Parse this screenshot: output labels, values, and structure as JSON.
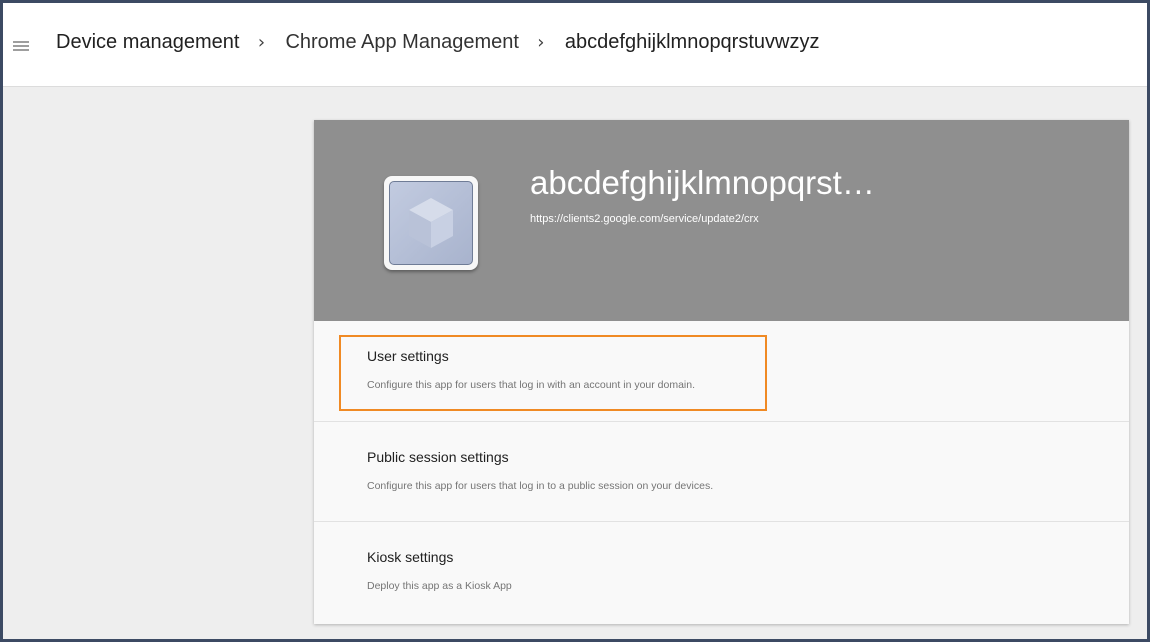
{
  "header": {
    "menu_icon": "menu-icon",
    "breadcrumb": [
      {
        "label": "Device management"
      },
      {
        "label": "Chrome App Management"
      },
      {
        "label": "abcdefghijklmnopqrstuvwzyz"
      }
    ],
    "separator_icon": "chevron-right-icon"
  },
  "app": {
    "icon": "app-cube-icon",
    "title": "abcdefghijklmnopqrst…",
    "url": "https://clients2.google.com/service/update2/crx"
  },
  "sections": [
    {
      "title": "User settings",
      "description": "Configure this app for users that log in with an account in your domain."
    },
    {
      "title": "Public session settings",
      "description": "Configure this app for users that log in to a public session on your devices."
    },
    {
      "title": "Kiosk settings",
      "description": "Deploy this app as a Kiosk App"
    }
  ],
  "colors": {
    "hero_background": "#8f8f8f",
    "highlight": "#f08a24",
    "frame_border": "#3c4a63"
  }
}
